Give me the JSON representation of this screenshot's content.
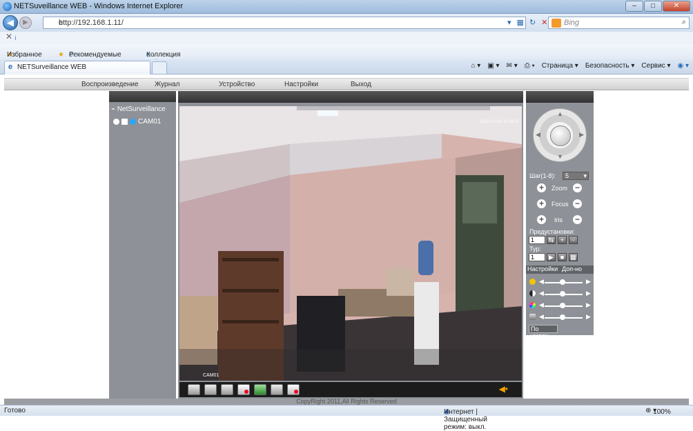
{
  "window": {
    "title": "NETSuveillance WEB - Windows Internet Explorer"
  },
  "address": {
    "url": "http://192.168.1.11/",
    "search_placeholder": "Bing"
  },
  "favorites": {
    "label": "Избранное",
    "recommended": "Рекомендуемые узлы ▾",
    "gallery": "Коллекция веб-фрагм... ▾"
  },
  "tab": {
    "label": "NETSurveillance WEB"
  },
  "commandbar": {
    "page": "Страница ▾",
    "security": "Безопасность ▾",
    "service": "Сервис ▾"
  },
  "appnav": {
    "playback": "Воспроизведение",
    "journal": "Журнал",
    "device": "Устройство",
    "settings": "Настройки",
    "exit": "Выход"
  },
  "tree": {
    "root": "NetSurveillance",
    "camera": "CAM01"
  },
  "video": {
    "timestamp": "2012-03-XX 12:08:27",
    "channel": "CAM01"
  },
  "ptz": {
    "step_label": "Шаг(1-8):",
    "step_value": "5",
    "zoom": "Zoom",
    "focus": "Focus",
    "iris": "Iris",
    "presets_label": "Предустановки:",
    "preset_value": "1",
    "tour_label": "Тур:",
    "tour_value": "1",
    "tab_settings": "Настройки",
    "tab_extra": "Доп-но",
    "default_button": "По умолч."
  },
  "footer": {
    "copyright": "CopyRight 2011,All Rights Reserved"
  },
  "statusbar": {
    "status": "Готово",
    "zone": "Интернет | Защищенный режим: выкл.",
    "zoom": "100%"
  }
}
